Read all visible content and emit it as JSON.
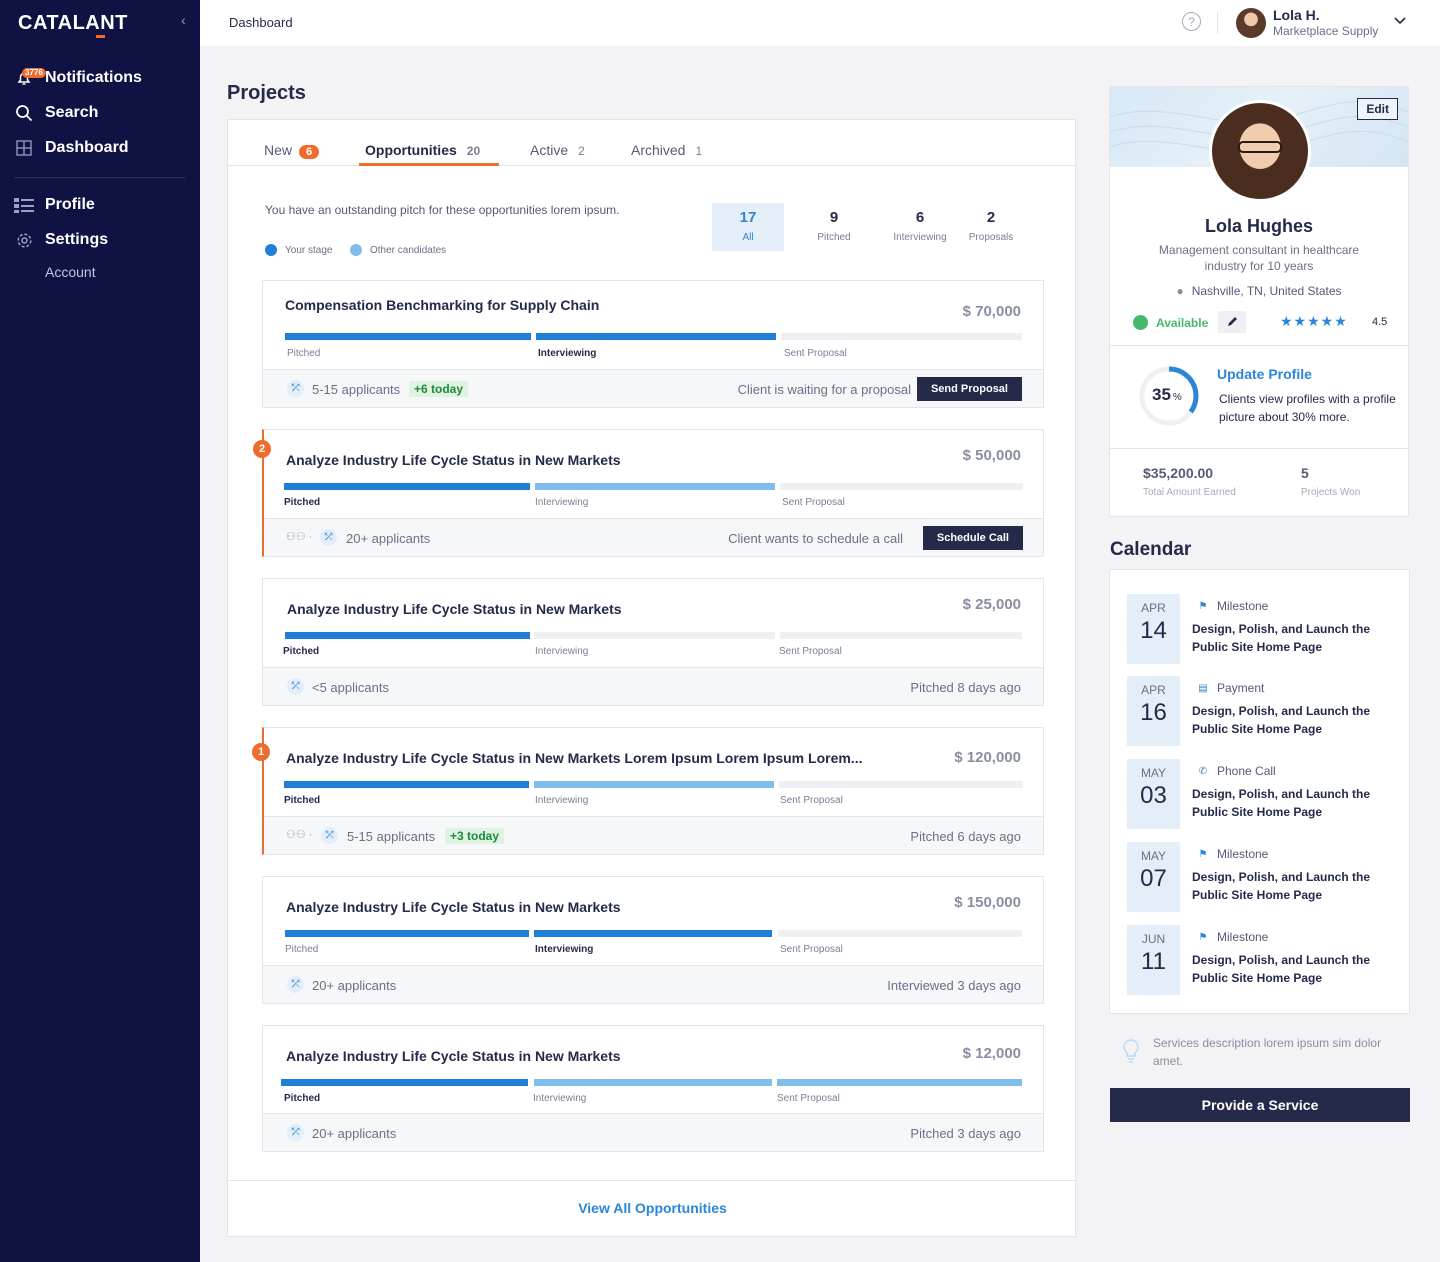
{
  "brand": {
    "logo": "CATALANT",
    "accent": "#ef6c2f",
    "navy": "#0f1243"
  },
  "sidebar": {
    "notifications": {
      "label": "Notifications",
      "badge": "3776"
    },
    "search": "Search",
    "dashboard": "Dashboard",
    "profile": "Profile",
    "settings": "Settings",
    "account": "Account"
  },
  "topbar": {
    "breadcrumb": "Dashboard",
    "help": "?",
    "user_name": "Lola H.",
    "user_role": "Marketplace Supply"
  },
  "projects": {
    "title": "Projects",
    "tabs": [
      {
        "label": "New",
        "count": "6"
      },
      {
        "label": "Opportunities",
        "count": "20"
      },
      {
        "label": "Active",
        "count": "2"
      },
      {
        "label": "Archived",
        "count": "1"
      }
    ],
    "description": "You have an outstanding pitch for these opportunities lorem ipsum.",
    "legend": {
      "your_stage": "Your stage",
      "other": "Other candidates"
    },
    "filters": [
      {
        "count": "17",
        "label": "All"
      },
      {
        "count": "9",
        "label": "Pitched"
      },
      {
        "count": "6",
        "label": "Interviewing"
      },
      {
        "count": "2",
        "label": "Proposals"
      }
    ],
    "stages": {
      "pitched": "Pitched",
      "interviewing": "Interviewing",
      "sent": "Sent Proposal"
    },
    "cards": [
      {
        "title": "Compensation Benchmarking for Supply Chain",
        "amount": "$ 70,000",
        "applicants": "5-15 applicants",
        "today": "+6 today",
        "note": "Client is waiting for a proposal",
        "button": "Send Proposal"
      },
      {
        "flag": "2",
        "title": "Analyze Industry Life Cycle Status in New Markets",
        "amount": "$ 50,000",
        "applicants": "20+ applicants",
        "note": "Client wants to schedule a call",
        "button": "Schedule Call"
      },
      {
        "title": "Analyze Industry Life Cycle Status in New Markets",
        "amount": "$ 25,000",
        "applicants": "<5 applicants",
        "note": "Pitched 8 days ago"
      },
      {
        "flag": "1",
        "title": "Analyze Industry Life Cycle Status in New Markets Lorem Ipsum Lorem Ipsum Lorem...",
        "amount": "$ 120,000",
        "applicants": "5-15 applicants",
        "today": "+3 today",
        "note": "Pitched 6 days ago"
      },
      {
        "title": "Analyze Industry Life Cycle Status in New Markets",
        "amount": "$ 150,000",
        "applicants": "20+ applicants",
        "note": "Interviewed 3 days ago"
      },
      {
        "title": "Analyze Industry Life Cycle Status in New Markets",
        "amount": "$ 12,000",
        "applicants": "20+ applicants",
        "note": "Pitched 3 days ago"
      }
    ],
    "view_all": "View All Opportunities"
  },
  "profile": {
    "edit": "Edit",
    "name": "Lola Hughes",
    "description": "Management consultant in healthcare industry for 10 years",
    "location": "Nashville, TN, United States",
    "status": "Available",
    "rating": "4.5",
    "completion": "35",
    "completion_unit": "%",
    "update_title": "Update Profile",
    "update_desc": "Clients view profiles with a profile picture  about 30% more.",
    "earned": "$35,200.00",
    "earned_label": "Total Amount Earned",
    "won": "5",
    "won_label": "Projects Won"
  },
  "calendar": {
    "title": "Calendar",
    "events": [
      {
        "month": "APR",
        "day": "14",
        "type": "Milestone",
        "title": "Design, Polish, and Launch the Public Site Home Page"
      },
      {
        "month": "APR",
        "day": "16",
        "type": "Payment",
        "title": "Design, Polish, and Launch the Public Site Home Page"
      },
      {
        "month": "MAY",
        "day": "03",
        "type": "Phone Call",
        "title": "Design, Polish, and Launch the Public Site Home Page"
      },
      {
        "month": "MAY",
        "day": "07",
        "type": "Milestone",
        "title": "Design, Polish, and Launch the Public Site Home Page"
      },
      {
        "month": "JUN",
        "day": "11",
        "type": "Milestone",
        "title": "Design, Polish, and Launch the Public Site Home Page"
      }
    ]
  },
  "services": {
    "description": "Services description lorem ipsum sim dolor amet.",
    "button": "Provide a Service"
  }
}
